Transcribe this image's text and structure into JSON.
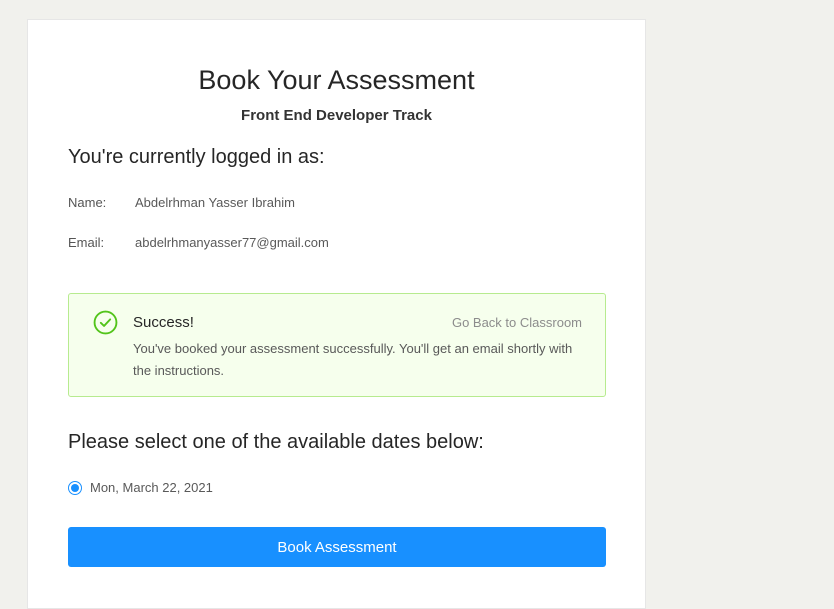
{
  "page": {
    "title": "Book Your Assessment",
    "subtitle": "Front End Developer Track"
  },
  "user_section": {
    "heading": "You're currently logged in as:",
    "name_label": "Name:",
    "name_value": "Abdelrhman Yasser Ibrahim",
    "email_label": "Email:",
    "email_value": "abdelrhmanyasser77@gmail.com"
  },
  "alert": {
    "icon": "check-circle-icon",
    "title": "Success!",
    "link": "Go Back to Classroom",
    "description": "You've booked your assessment successfully. You'll get an email shortly with the instructions."
  },
  "dates_section": {
    "heading": "Please select one of the available dates below:",
    "options": [
      {
        "label": "Mon, March 22, 2021",
        "selected": true
      }
    ]
  },
  "actions": {
    "book_label": "Book Assessment"
  },
  "colors": {
    "primary": "#1890ff",
    "success": "#52c41a",
    "success_bg": "#f6ffed",
    "success_border": "#b7eb8f",
    "page_bg": "#f1f1ed"
  }
}
